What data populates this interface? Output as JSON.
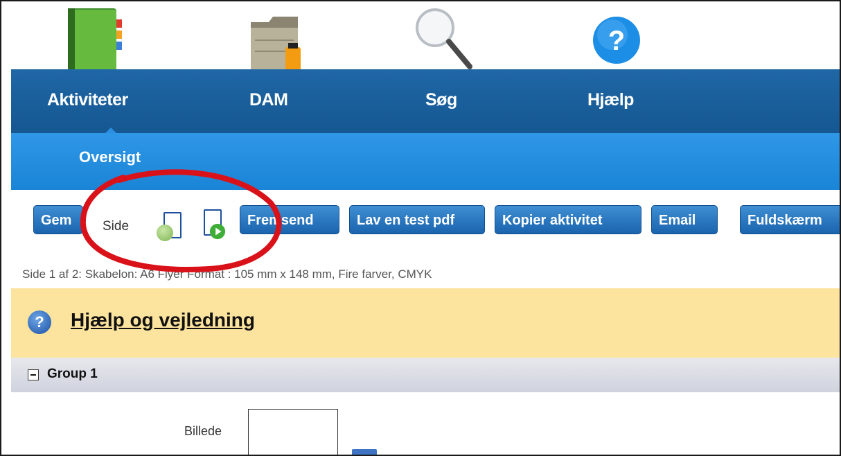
{
  "nav": {
    "items": [
      {
        "label": "Aktiviteter",
        "icon": "address-book-icon"
      },
      {
        "label": "DAM",
        "icon": "folder-icon"
      },
      {
        "label": "Søg",
        "icon": "magnifier-icon"
      },
      {
        "label": "Hjælp",
        "icon": "help-icon"
      }
    ]
  },
  "subnav": {
    "label": "Oversigt"
  },
  "toolbar": {
    "gem": "Gem",
    "side_label": "Side",
    "fremsend": "Fremsend",
    "testpdf": "Lav en test pdf",
    "kopier": "Kopier aktivitet",
    "email": "Email",
    "fuldskaerm": "Fuldskærm"
  },
  "info": "Side 1 af 2: Skabelon: A6 Flyer    Format : 105 mm x 148 mm, Fire farver, CMYK",
  "help": {
    "link": "Hjælp og vejledning",
    "icon_char": "?"
  },
  "group": {
    "label": "Group 1"
  },
  "field": {
    "label": "Billede"
  },
  "colors": {
    "mainnav": "#1a5f9d",
    "subnav": "#2790e0",
    "button": "#2a74bd",
    "helpband": "#fde49e",
    "annotation": "#d9121a"
  }
}
